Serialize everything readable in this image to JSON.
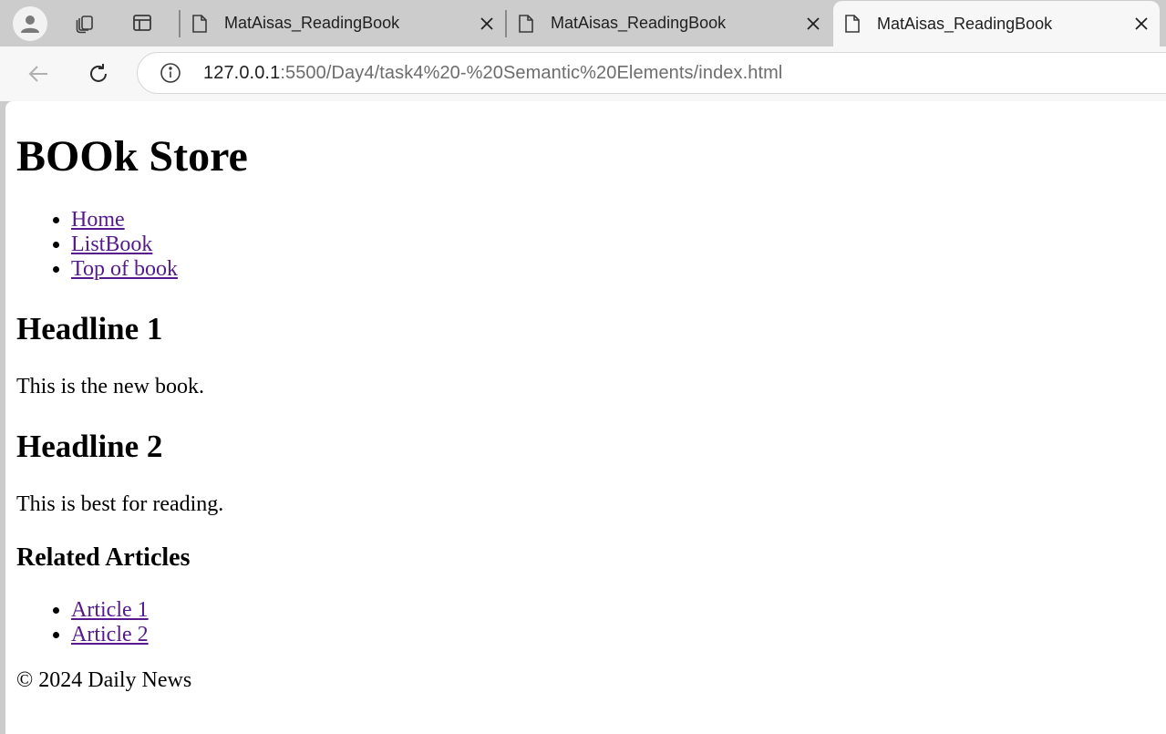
{
  "browser": {
    "tabs": [
      {
        "title": "MatAisas_ReadingBook",
        "active": false
      },
      {
        "title": "MatAisas_ReadingBook",
        "active": false
      },
      {
        "title": "MatAisas_ReadingBook",
        "active": true
      }
    ],
    "address": {
      "host": "127.0.0.1",
      "rest": ":5500/Day4/task4%20-%20Semantic%20Elements/index.html"
    }
  },
  "page": {
    "title": "BOOk Store",
    "nav": [
      "Home",
      "ListBook",
      "Top of book"
    ],
    "sections": [
      {
        "heading": "Headline 1",
        "text": "This is the new book."
      },
      {
        "heading": "Headline 2",
        "text": "This is best for reading."
      }
    ],
    "related": {
      "heading": "Related Articles",
      "links": [
        "Article 1",
        "Article 2"
      ]
    },
    "footer": "© 2024 Daily News"
  },
  "colors": {
    "link_visited": "#551a8b",
    "tabstrip_bg": "#cccccc",
    "toolbar_bg": "#f7f7f7"
  }
}
